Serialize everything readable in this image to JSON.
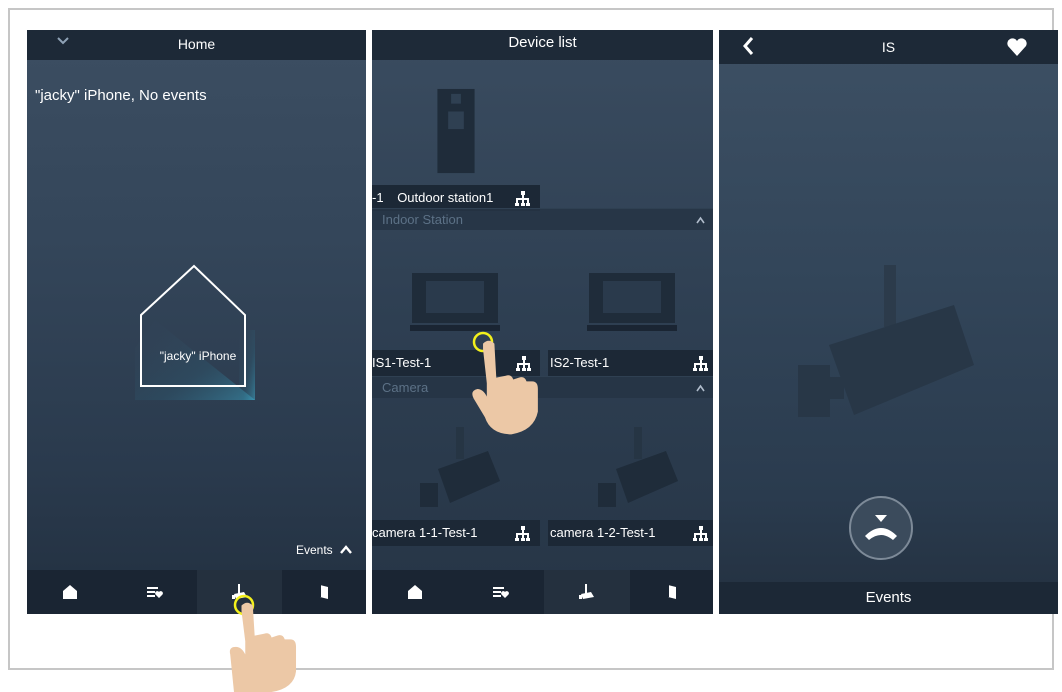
{
  "screen1": {
    "title": "Home",
    "status": "\"jacky\" iPhone, No events",
    "house_label": "\"jacky\" iPhone",
    "events_label": "Events",
    "tabs": [
      "home-icon",
      "favorites-icon",
      "device-list-icon",
      "door-icon"
    ],
    "active_tab": 2
  },
  "screen2": {
    "title": "Device list",
    "outdoor_label": "Outdoor station1",
    "outdoor_prefix": "-1",
    "sections": {
      "indoor": "Indoor Station",
      "camera": "Camera"
    },
    "indoor_devices": [
      "IS1-Test-1",
      "IS2-Test-1"
    ],
    "camera_devices": [
      "camera 1-1-Test-1",
      "camera 1-2-Test-1"
    ],
    "tabs": [
      "home-icon",
      "favorites-icon",
      "device-list-icon",
      "door-icon"
    ],
    "active_tab": 2
  },
  "screen3": {
    "title": "IS",
    "events_label": "Events"
  },
  "colors": {
    "accent_ring": "#f3f01c",
    "topbar": "#1d2937",
    "bottombar": "#1a2533",
    "house_glow": "#3fb0d0"
  }
}
